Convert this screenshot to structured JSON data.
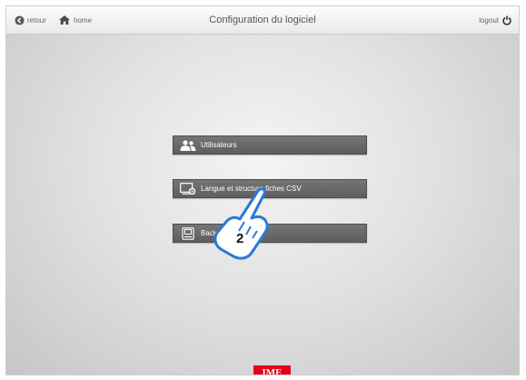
{
  "header": {
    "back_label": "retour",
    "home_label": "home",
    "title": "Configuration du logiciel",
    "logout_label": "logout"
  },
  "menu": {
    "items": [
      {
        "label": "Utilisateurs",
        "icon": "users-icon"
      },
      {
        "label": "Langue et structure fiches CSV",
        "icon": "screen-settings-icon"
      },
      {
        "label": "Backup logiciel",
        "icon": "backup-icon"
      }
    ]
  },
  "callout": {
    "step_number": "2",
    "icon": "pointing-hand-icon"
  },
  "footer": {
    "brand_logo_text": "IME"
  },
  "colors": {
    "button_bg": "#666666",
    "brand_red": "#e3001b",
    "callout_blue": "#2a7bd4"
  }
}
